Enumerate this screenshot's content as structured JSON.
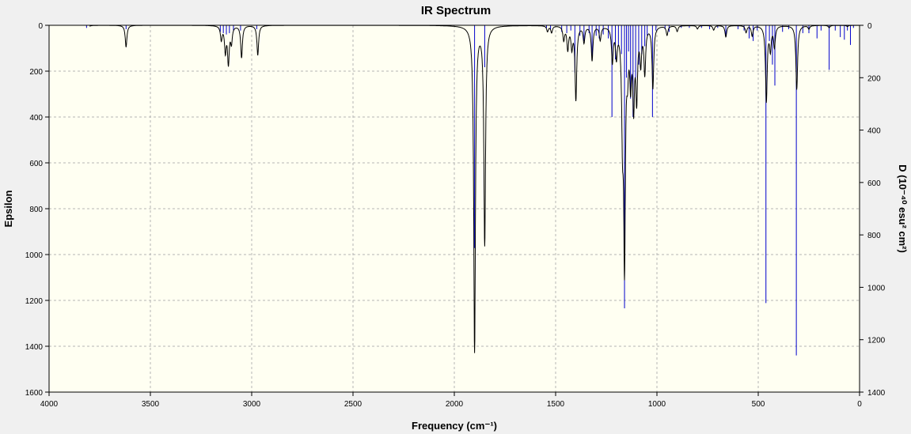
{
  "chart_data": {
    "type": "line",
    "title": "IR Spectrum",
    "xlabel": "Frequency (cm⁻¹)",
    "ylabel": "Epsilon",
    "y2label": "D (10⁻⁴⁰ esu² cm²)",
    "xlim": [
      4000,
      0
    ],
    "ylim": [
      0,
      1600
    ],
    "y2lim": [
      0,
      1400
    ],
    "x_ticks": [
      "4000",
      "3500",
      "3000",
      "2500",
      "2000",
      "1500",
      "1000",
      "500",
      "0"
    ],
    "y_ticks": [
      "0",
      "200",
      "400",
      "600",
      "800",
      "1000",
      "1200",
      "1400",
      "1600"
    ],
    "y2_ticks": [
      "0",
      "200",
      "400",
      "600",
      "800",
      "1000",
      "1200",
      "1400"
    ],
    "grid": true,
    "y_inverted": true,
    "colors": {
      "spectrum": "#000000",
      "sticks": "#0000cc",
      "plot_bg": "#fffff2",
      "grid": "#b4b4b4"
    },
    "series": [
      {
        "kind": "broadened_spectrum",
        "peaks": [
          {
            "x": 3815,
            "y": 40
          },
          {
            "x": 3620,
            "y": 95
          },
          {
            "x": 3150,
            "y": 60
          },
          {
            "x": 3130,
            "y": 110
          },
          {
            "x": 3115,
            "y": 160
          },
          {
            "x": 3100,
            "y": 70
          },
          {
            "x": 3050,
            "y": 140
          },
          {
            "x": 2970,
            "y": 130
          },
          {
            "x": 1900,
            "y": 1420
          },
          {
            "x": 1850,
            "y": 950
          },
          {
            "x": 1540,
            "y": 25
          },
          {
            "x": 1520,
            "y": 30
          },
          {
            "x": 1460,
            "y": 60
          },
          {
            "x": 1440,
            "y": 100
          },
          {
            "x": 1420,
            "y": 90
          },
          {
            "x": 1400,
            "y": 320
          },
          {
            "x": 1360,
            "y": 70
          },
          {
            "x": 1320,
            "y": 150
          },
          {
            "x": 1280,
            "y": 60
          },
          {
            "x": 1220,
            "y": 150
          },
          {
            "x": 1200,
            "y": 120
          },
          {
            "x": 1170,
            "y": 400
          },
          {
            "x": 1160,
            "y": 1000
          },
          {
            "x": 1145,
            "y": 150
          },
          {
            "x": 1130,
            "y": 220
          },
          {
            "x": 1115,
            "y": 330
          },
          {
            "x": 1100,
            "y": 300
          },
          {
            "x": 1080,
            "y": 150
          },
          {
            "x": 1060,
            "y": 200
          },
          {
            "x": 1020,
            "y": 270
          },
          {
            "x": 950,
            "y": 40
          },
          {
            "x": 900,
            "y": 25
          },
          {
            "x": 800,
            "y": 15
          },
          {
            "x": 720,
            "y": 20
          },
          {
            "x": 660,
            "y": 50
          },
          {
            "x": 560,
            "y": 30
          },
          {
            "x": 530,
            "y": 45
          },
          {
            "x": 460,
            "y": 330
          },
          {
            "x": 440,
            "y": 100
          },
          {
            "x": 420,
            "y": 90
          },
          {
            "x": 310,
            "y": 280
          },
          {
            "x": 250,
            "y": 15
          },
          {
            "x": 150,
            "y": 10
          },
          {
            "x": 60,
            "y": 5
          }
        ]
      },
      {
        "kind": "sticks",
        "points": [
          {
            "x": 3815,
            "y": 10
          },
          {
            "x": 3620,
            "y": 15
          },
          {
            "x": 3155,
            "y": 25
          },
          {
            "x": 3140,
            "y": 30
          },
          {
            "x": 3125,
            "y": 35
          },
          {
            "x": 3110,
            "y": 30
          },
          {
            "x": 3090,
            "y": 20
          },
          {
            "x": 3055,
            "y": 20
          },
          {
            "x": 2975,
            "y": 15
          },
          {
            "x": 1900,
            "y": 850
          },
          {
            "x": 1850,
            "y": 160
          },
          {
            "x": 1545,
            "y": 10
          },
          {
            "x": 1525,
            "y": 15
          },
          {
            "x": 1470,
            "y": 25
          },
          {
            "x": 1445,
            "y": 30
          },
          {
            "x": 1425,
            "y": 20
          },
          {
            "x": 1405,
            "y": 180
          },
          {
            "x": 1380,
            "y": 40
          },
          {
            "x": 1360,
            "y": 60
          },
          {
            "x": 1335,
            "y": 30
          },
          {
            "x": 1320,
            "y": 120
          },
          {
            "x": 1300,
            "y": 40
          },
          {
            "x": 1285,
            "y": 50
          },
          {
            "x": 1265,
            "y": 35
          },
          {
            "x": 1240,
            "y": 50
          },
          {
            "x": 1222,
            "y": 350
          },
          {
            "x": 1205,
            "y": 130
          },
          {
            "x": 1190,
            "y": 80
          },
          {
            "x": 1175,
            "y": 110
          },
          {
            "x": 1160,
            "y": 1080
          },
          {
            "x": 1150,
            "y": 200
          },
          {
            "x": 1140,
            "y": 100
          },
          {
            "x": 1130,
            "y": 280
          },
          {
            "x": 1118,
            "y": 350
          },
          {
            "x": 1105,
            "y": 200
          },
          {
            "x": 1090,
            "y": 150
          },
          {
            "x": 1075,
            "y": 110
          },
          {
            "x": 1060,
            "y": 80
          },
          {
            "x": 1048,
            "y": 40
          },
          {
            "x": 1022,
            "y": 350
          },
          {
            "x": 1005,
            "y": 20
          },
          {
            "x": 960,
            "y": 15
          },
          {
            "x": 940,
            "y": 25
          },
          {
            "x": 880,
            "y": 10
          },
          {
            "x": 840,
            "y": 10
          },
          {
            "x": 780,
            "y": 10
          },
          {
            "x": 740,
            "y": 15
          },
          {
            "x": 700,
            "y": 10
          },
          {
            "x": 660,
            "y": 45
          },
          {
            "x": 600,
            "y": 15
          },
          {
            "x": 570,
            "y": 20
          },
          {
            "x": 545,
            "y": 50
          },
          {
            "x": 525,
            "y": 60
          },
          {
            "x": 505,
            "y": 20
          },
          {
            "x": 462,
            "y": 1060
          },
          {
            "x": 445,
            "y": 60
          },
          {
            "x": 430,
            "y": 150
          },
          {
            "x": 418,
            "y": 230
          },
          {
            "x": 380,
            "y": 25
          },
          {
            "x": 350,
            "y": 15
          },
          {
            "x": 312,
            "y": 1260
          },
          {
            "x": 280,
            "y": 30
          },
          {
            "x": 250,
            "y": 30
          },
          {
            "x": 210,
            "y": 50
          },
          {
            "x": 190,
            "y": 20
          },
          {
            "x": 150,
            "y": 170
          },
          {
            "x": 120,
            "y": 20
          },
          {
            "x": 95,
            "y": 45
          },
          {
            "x": 75,
            "y": 55
          },
          {
            "x": 60,
            "y": 20
          },
          {
            "x": 45,
            "y": 75
          },
          {
            "x": 30,
            "y": 10
          }
        ]
      }
    ]
  }
}
